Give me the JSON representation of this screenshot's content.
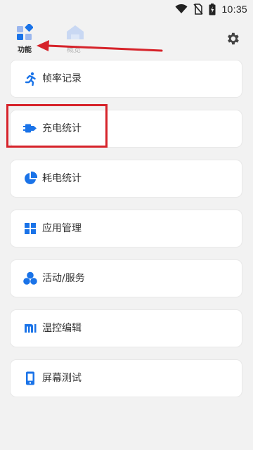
{
  "status_bar": {
    "time": "10:35"
  },
  "nav": {
    "tabs": [
      {
        "label": "功能",
        "active": true
      },
      {
        "label": "概览",
        "active": false
      }
    ]
  },
  "menu": {
    "items": [
      {
        "label": "帧率记录",
        "icon": "running-person-icon"
      },
      {
        "label": "充电统计",
        "icon": "charger-plug-icon"
      },
      {
        "label": "耗电统计",
        "icon": "pie-chart-icon"
      },
      {
        "label": "应用管理",
        "icon": "app-grid-icon"
      },
      {
        "label": "活动/服务",
        "icon": "circles-cluster-icon"
      },
      {
        "label": "温控编辑",
        "icon": "mi-logo-icon"
      },
      {
        "label": "屏幕测试",
        "icon": "phone-screen-icon"
      }
    ]
  },
  "colors": {
    "accent": "#1a73e8",
    "annotation": "#d6232a",
    "background": "#f2f2f2"
  }
}
